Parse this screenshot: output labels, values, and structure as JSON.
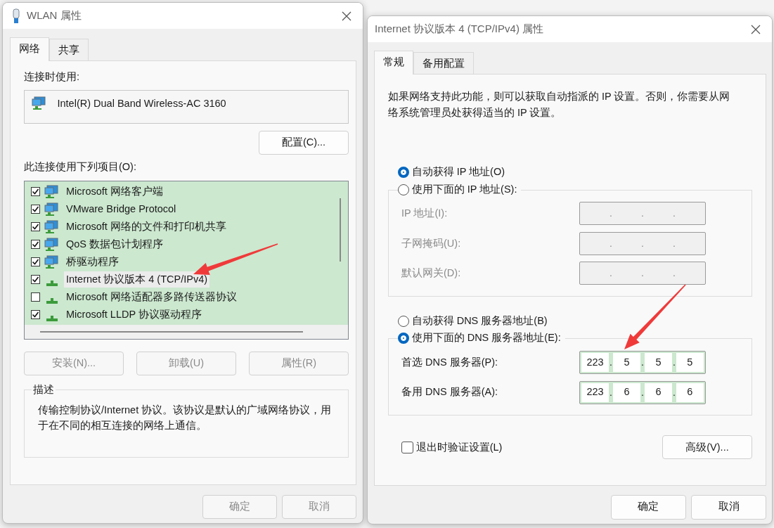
{
  "wlan_dialog": {
    "title": "WLAN 属性",
    "tabs": [
      {
        "label": "网络",
        "selected": true
      },
      {
        "label": "共享",
        "selected": false
      }
    ],
    "connect_using_label": "连接时使用:",
    "adapter": "Intel(R) Dual Band Wireless-AC 3160",
    "configure_button": "配置(C)...",
    "items_label": "此连接使用下列项目(O):",
    "items": [
      {
        "label": "Microsoft 网络客户端",
        "checked": true,
        "kind": "client",
        "selected": false
      },
      {
        "label": "VMware Bridge Protocol",
        "checked": true,
        "kind": "service",
        "selected": false
      },
      {
        "label": "Microsoft 网络的文件和打印机共享",
        "checked": true,
        "kind": "service",
        "selected": false
      },
      {
        "label": "QoS 数据包计划程序",
        "checked": true,
        "kind": "service",
        "selected": false
      },
      {
        "label": "桥驱动程序",
        "checked": true,
        "kind": "service",
        "selected": false
      },
      {
        "label": "Internet 协议版本 4 (TCP/IPv4)",
        "checked": true,
        "kind": "protocol",
        "selected": true
      },
      {
        "label": "Microsoft 网络适配器多路传送器协议",
        "checked": false,
        "kind": "protocol",
        "selected": false
      },
      {
        "label": "Microsoft LLDP 协议驱动程序",
        "checked": true,
        "kind": "protocol",
        "selected": false
      }
    ],
    "item_buttons": [
      {
        "label": "安装(N)...",
        "disabled": true
      },
      {
        "label": "卸载(U)",
        "disabled": true
      },
      {
        "label": "属性(R)",
        "disabled": true
      }
    ],
    "description": {
      "legend": "描述",
      "text": "传输控制协议/Internet 协议。该协议是默认的广域网络协议，用于在不同的相互连接的网络上通信。"
    },
    "buttons": [
      {
        "label": "确定",
        "disabled": true
      },
      {
        "label": "取消",
        "disabled": true
      }
    ]
  },
  "ipv4_dialog": {
    "title": "Internet 协议版本 4 (TCP/IPv4) 属性",
    "tabs": [
      {
        "label": "常规",
        "selected": true
      },
      {
        "label": "备用配置",
        "selected": false
      }
    ],
    "intro": "如果网络支持此功能，则可以获取自动指派的 IP 设置。否则，你需要从网络系统管理员处获得适当的 IP 设置。",
    "ip_modes": [
      {
        "label": "自动获得 IP 地址(O)",
        "selected": true
      },
      {
        "label": "使用下面的 IP 地址(S):",
        "selected": false
      }
    ],
    "ip_fields": [
      {
        "label": "IP 地址(I):",
        "disabled": true,
        "separator": "."
      },
      {
        "label": "子网掩码(U):",
        "disabled": true,
        "separator": "."
      },
      {
        "label": "默认网关(D):",
        "disabled": true,
        "separator": "."
      }
    ],
    "dns_modes": [
      {
        "label": "自动获得 DNS 服务器地址(B)",
        "selected": false
      },
      {
        "label": "使用下面的 DNS 服务器地址(E):",
        "selected": true
      }
    ],
    "dns_fields": [
      {
        "label": "首选 DNS 服务器(P):",
        "disabled": false,
        "separator": ".",
        "octets": [
          "223",
          "5",
          "5",
          "5"
        ]
      },
      {
        "label": "备用 DNS 服务器(A):",
        "disabled": false,
        "separator": ".",
        "octets": [
          "223",
          "6",
          "6",
          "6"
        ]
      }
    ],
    "validate_on_exit": {
      "label": "退出时验证设置(L)",
      "checked": false
    },
    "advanced_button": "高级(V)...",
    "buttons": [
      {
        "label": "确定",
        "disabled": false
      },
      {
        "label": "取消",
        "disabled": false
      }
    ]
  }
}
